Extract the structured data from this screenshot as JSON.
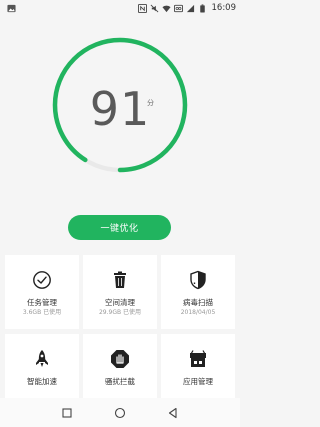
{
  "status_bar": {
    "time": "16:09",
    "icons": [
      "image-icon",
      "nfc-icon",
      "mute-icon",
      "wifi-icon",
      "sim-icon",
      "signal-icon",
      "battery-icon"
    ]
  },
  "score": {
    "value": "91",
    "unit": "分",
    "progress": 0.91,
    "colors": {
      "progress": "#21b45f",
      "track": "#e9e9e9"
    }
  },
  "optimize_button": {
    "label": "一键优化",
    "color": "#21b45f"
  },
  "tools": [
    {
      "icon": "check-circle-icon",
      "label": "任务管理",
      "sub": "3.6GB 已使用"
    },
    {
      "icon": "trash-icon",
      "label": "空间清理",
      "sub": "29.9GB 已使用"
    },
    {
      "icon": "shield-icon",
      "label": "病毒扫描",
      "sub": "2018/04/05"
    },
    {
      "icon": "rocket-icon",
      "label": "智能加速",
      "sub": ""
    },
    {
      "icon": "stop-hand-icon",
      "label": "骚扰拦截",
      "sub": ""
    },
    {
      "icon": "app-manager-icon",
      "label": "应用管理",
      "sub": ""
    }
  ],
  "nav": {
    "icons": [
      "recent-apps-icon",
      "home-icon",
      "back-icon"
    ]
  }
}
